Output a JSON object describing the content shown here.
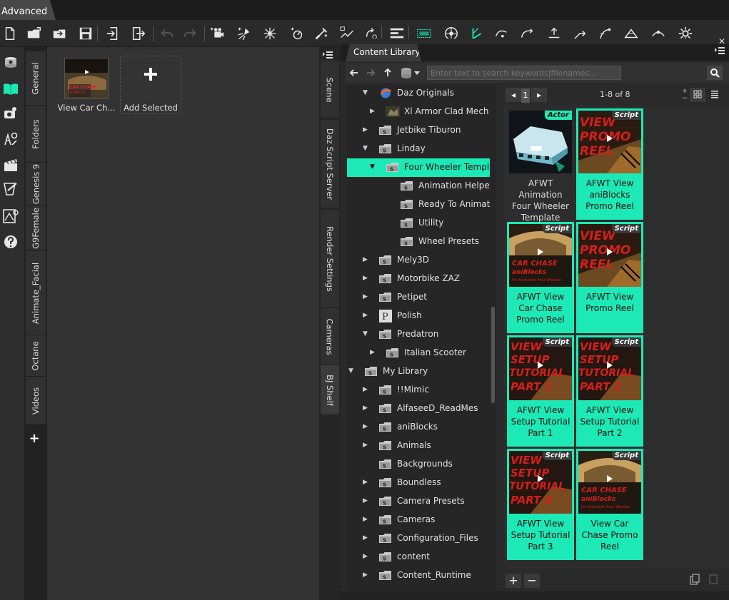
{
  "app": {
    "tab_title": "Advanced"
  },
  "toolbar": {
    "icons": [
      "new-file-icon",
      "open-folder-icon",
      "merge-folder-icon",
      "save-icon",
      "import-icon",
      "export-icon",
      "undo-icon",
      "redo-icon",
      "add-camera-icon",
      "spotlight-icon",
      "distant-light-icon",
      "point-light-icon",
      "render-icon",
      "transform-icon",
      "rotate-icon",
      "viewport-icon",
      "node-selection-icon",
      "figure-tool-icon",
      "camera-orbit-icon",
      "camera-pan-icon",
      "camera-dolly-icon",
      "pose-icon",
      "joint-icon",
      "surface-icon",
      "geometry-icon",
      "deform-icon",
      "settings-icon"
    ]
  },
  "left_icons": [
    "scene-icon",
    "content-library-icon",
    "camera-panel-icon",
    "timeline-icon",
    "clapper-icon",
    "render-tool-icon",
    "pose-tool-icon",
    "help-icon"
  ],
  "left_tabs": [
    "General",
    "Folders",
    "Genesis 9",
    "G9Female",
    "Animate_Facial",
    "Octane",
    "Videos"
  ],
  "shelf": {
    "items": [
      {
        "label": "View Car Ch..."
      },
      {
        "label": "Add Selected"
      }
    ]
  },
  "right_tabs": [
    "Scene",
    "Daz Script Server",
    "Render Settings",
    "Cameras",
    "BJ Shelf"
  ],
  "content_library": {
    "tab_title": "Content Library",
    "search_placeholder": "Enter text to search keywords|filenames...",
    "page": "1",
    "count": "1-8 of 8",
    "tree": [
      {
        "label": "Daz Originals",
        "depth": 1,
        "expanded": true,
        "icon": "daz-icon"
      },
      {
        "label": "Xl Armor Clad Mech",
        "depth": 2,
        "expanded": false,
        "icon": "thumb-icon"
      },
      {
        "label": "Jetbike Tiburon",
        "depth": 1,
        "expanded": false,
        "icon": "folder-icon"
      },
      {
        "label": "Linday",
        "depth": 1,
        "expanded": true,
        "icon": "folder-icon"
      },
      {
        "label": "Four Wheeler Templ...",
        "depth": 2,
        "expanded": true,
        "icon": "folder-icon",
        "selected": true
      },
      {
        "label": "Animation Helpers",
        "depth": 3,
        "expanded": null,
        "icon": "folder-icon"
      },
      {
        "label": "Ready To Animate...",
        "depth": 3,
        "expanded": null,
        "icon": "folder-icon"
      },
      {
        "label": "Utility",
        "depth": 3,
        "expanded": null,
        "icon": "folder-icon"
      },
      {
        "label": "Wheel Presets",
        "depth": 3,
        "expanded": null,
        "icon": "folder-icon"
      },
      {
        "label": "Mely3D",
        "depth": 1,
        "expanded": false,
        "icon": "folder-icon"
      },
      {
        "label": "Motorbike ZAZ",
        "depth": 1,
        "expanded": false,
        "icon": "folder-icon"
      },
      {
        "label": "Petipet",
        "depth": 1,
        "expanded": false,
        "icon": "folder-icon"
      },
      {
        "label": "Polish",
        "depth": 1,
        "expanded": false,
        "icon": "p-icon"
      },
      {
        "label": "Predatron",
        "depth": 1,
        "expanded": true,
        "icon": "folder-icon"
      },
      {
        "label": "Italian Scooter",
        "depth": 2,
        "expanded": false,
        "icon": "folder-icon"
      },
      {
        "label": "My Library",
        "depth": 0,
        "expanded": true,
        "icon": "folder-icon"
      },
      {
        "label": "!!Mimic",
        "depth": 1,
        "expanded": false,
        "icon": "folder-icon"
      },
      {
        "label": "AlfaseeD_ReadMes",
        "depth": 1,
        "expanded": false,
        "icon": "folder-icon"
      },
      {
        "label": "aniBlocks",
        "depth": 1,
        "expanded": false,
        "icon": "folder-icon"
      },
      {
        "label": "Animals",
        "depth": 1,
        "expanded": false,
        "icon": "folder-icon"
      },
      {
        "label": "Backgrounds",
        "depth": 1,
        "expanded": null,
        "icon": "folder-icon"
      },
      {
        "label": "Boundless",
        "depth": 1,
        "expanded": false,
        "icon": "folder-icon"
      },
      {
        "label": "Camera Presets",
        "depth": 1,
        "expanded": false,
        "icon": "folder-icon"
      },
      {
        "label": "Cameras",
        "depth": 1,
        "expanded": false,
        "icon": "folder-icon"
      },
      {
        "label": "Configuration_Files",
        "depth": 1,
        "expanded": false,
        "icon": "folder-icon"
      },
      {
        "label": "content",
        "depth": 1,
        "expanded": false,
        "icon": "folder-icon"
      },
      {
        "label": "Content_Runtime",
        "depth": 1,
        "expanded": false,
        "icon": "folder-icon"
      }
    ],
    "assets": [
      {
        "title": "AFWT Animation Four Wheeler Template",
        "badge": "Actor",
        "selected": false,
        "thumb": "car"
      },
      {
        "title": "AFWT View aniBlocks Promo Reel",
        "badge": "Script",
        "selected": true,
        "thumb": "promo",
        "thumb_text": "VIEW PROMO REEL"
      },
      {
        "title": "AFWT View Car Chase Promo Reel",
        "badge": "Script",
        "selected": true,
        "thumb": "chase",
        "thumb_text": "CAR CHASE ANIBLOCKS"
      },
      {
        "title": "AFWT View Promo Reel",
        "badge": "Script",
        "selected": true,
        "thumb": "promo",
        "thumb_text": "VIEW PROMO REEL"
      },
      {
        "title": "AFWT View Setup Tutorial Part 1",
        "badge": "Script",
        "selected": true,
        "thumb": "tutorial",
        "thumb_text": "VIEW SETUP TUTORIAL PART 1"
      },
      {
        "title": "AFWT View Setup Tutorial Part 2",
        "badge": "Script",
        "selected": true,
        "thumb": "tutorial",
        "thumb_text": "VIEW SETUP TUTORIAL PART 2"
      },
      {
        "title": "AFWT View Setup Tutorial Part 3",
        "badge": "Script",
        "selected": true,
        "thumb": "tutorial",
        "thumb_text": "VIEW SETUP TUTORIAL PART 3"
      },
      {
        "title": "View Car Chase Promo Reel",
        "badge": "Script",
        "selected": true,
        "thumb": "chase",
        "thumb_text": "CAR CHASE ANIBLOCKS"
      }
    ],
    "bottom_buttons": [
      "+",
      "−"
    ]
  },
  "colors": {
    "accent": "#1de9b6",
    "folder": "#c8c8c8",
    "dark_bg": "#2a2a2a"
  }
}
